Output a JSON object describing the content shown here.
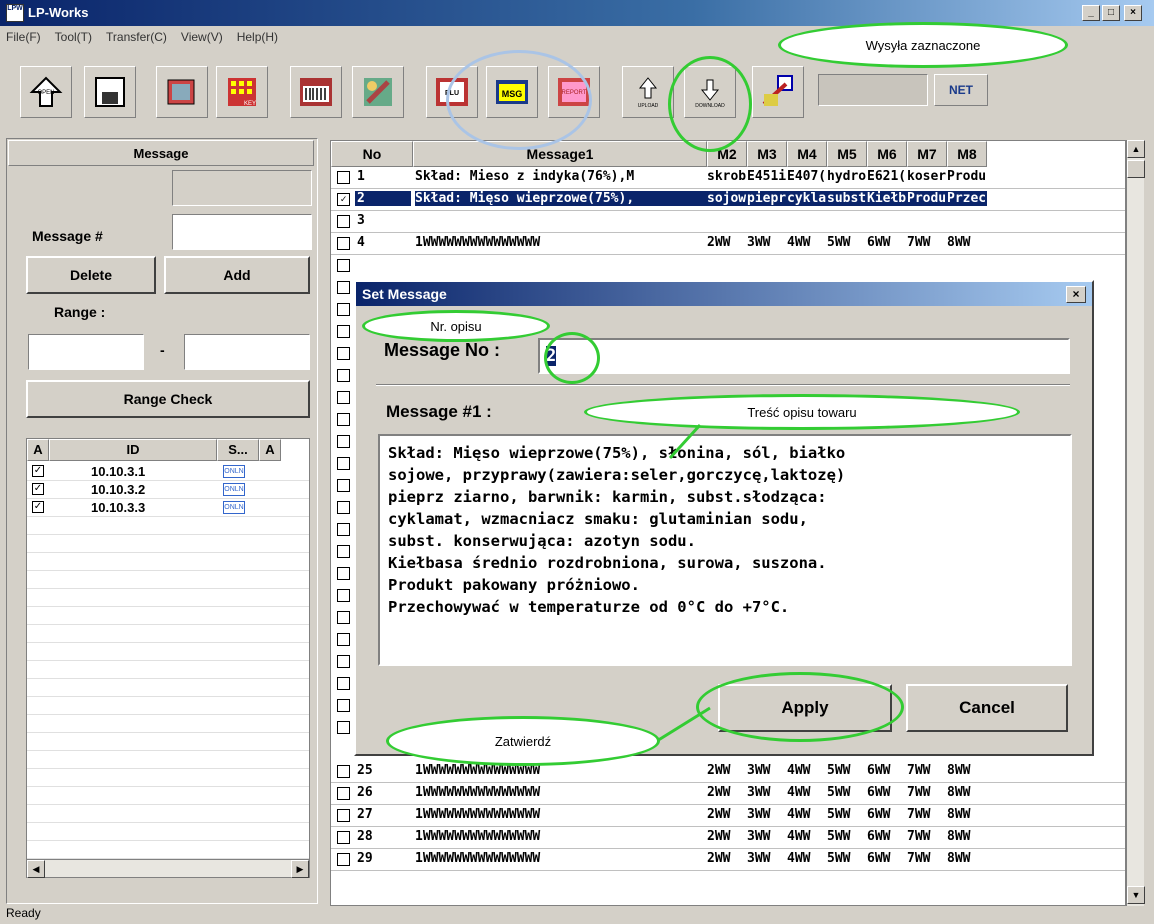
{
  "window": {
    "title": "LP-Works",
    "icon_text": "LPW",
    "min": "_",
    "max": "□",
    "close": "×"
  },
  "menu": [
    "File(F)",
    "Tool(T)",
    "Transfer(C)",
    "View(V)",
    "Help(H)"
  ],
  "toolbar": {
    "buttons": [
      {
        "name": "open-icon",
        "label": "OPEN"
      },
      {
        "name": "save-icon",
        "label": ""
      },
      {
        "name": "layout-icon",
        "label": ""
      },
      {
        "name": "key-icon",
        "label": "KEY"
      },
      {
        "name": "label-icon",
        "label": "LABEL"
      },
      {
        "name": "paint-icon",
        "label": ""
      },
      {
        "name": "plu-icon",
        "label": "PLU"
      },
      {
        "name": "msg-icon",
        "label": "MSG"
      },
      {
        "name": "report-icon",
        "label": "REPORT"
      },
      {
        "name": "upload-icon",
        "label": "UPLOAD"
      },
      {
        "name": "download-icon",
        "label": "DOWNLOAD"
      },
      {
        "name": "config-icon",
        "label": ""
      }
    ],
    "net_label": "NET"
  },
  "left": {
    "header": "Message",
    "message_num_label": "Message #",
    "delete": "Delete",
    "add": "Add",
    "range_label": "Range :",
    "range_sep": "-",
    "range_check": "Range Check",
    "list_headers": [
      "A",
      "ID",
      "S...",
      "A"
    ],
    "ids": [
      "10.10.3.1",
      "10.10.3.2",
      "10.10.3.3"
    ],
    "status_icon_text": "ONLN"
  },
  "grid": {
    "headers": [
      "No",
      "Message1",
      "M2",
      "M3",
      "M4",
      "M5",
      "M6",
      "M7",
      "M8"
    ],
    "rows": [
      {
        "no": "1",
        "m1": "Skład: Mieso z indyka(76%),M",
        "m": [
          "skrob",
          "E451i",
          "E407(",
          "hydro",
          "E621(",
          "koser",
          "Produ"
        ]
      },
      {
        "no": "2",
        "m1": "Skład: Mięso wieprzowe(75%),",
        "m": [
          "sojow",
          "piepr",
          "cykla",
          "subst",
          "Kiełb",
          "Produ",
          "Przec"
        ],
        "selected": true,
        "checked": true
      },
      {
        "no": "3",
        "m1": "",
        "m": [
          "",
          "",
          "",
          "",
          "",
          "",
          ""
        ]
      },
      {
        "no": "4",
        "m1": "1WWWWWWWWWWWWWWW",
        "m": [
          "2WW",
          "3WW",
          "4WW",
          "5WW",
          "6WW",
          "7WW",
          "8WW"
        ]
      },
      {
        "no": "25",
        "m1": "1WWWWWWWWWWWWWWW",
        "m": [
          "2WW",
          "3WW",
          "4WW",
          "5WW",
          "6WW",
          "7WW",
          "8WW"
        ]
      },
      {
        "no": "26",
        "m1": "1WWWWWWWWWWWWWWW",
        "m": [
          "2WW",
          "3WW",
          "4WW",
          "5WW",
          "6WW",
          "7WW",
          "8WW"
        ]
      },
      {
        "no": "27",
        "m1": "1WWWWWWWWWWWWWWW",
        "m": [
          "2WW",
          "3WW",
          "4WW",
          "5WW",
          "6WW",
          "7WW",
          "8WW"
        ]
      },
      {
        "no": "28",
        "m1": "1WWWWWWWWWWWWWWW",
        "m": [
          "2WW",
          "3WW",
          "4WW",
          "5WW",
          "6WW",
          "7WW",
          "8WW"
        ]
      },
      {
        "no": "29",
        "m1": "1WWWWWWWWWWWWWWW",
        "m": [
          "2WW",
          "3WW",
          "4WW",
          "5WW",
          "6WW",
          "7WW",
          "8WW"
        ]
      }
    ]
  },
  "dialog": {
    "title": "Set Message",
    "close": "×",
    "message_no_label": "Message No :",
    "message_no_value": "2",
    "message1_label": "Message #1 :",
    "message_text": "Skład: Mięso wieprzowe(75%), słonina, sól, białko\nsojowe, przyprawy(zawiera:seler,gorczycę,laktozę)\npieprz ziarno, barwnik: karmin, subst.słodząca:\ncyklamat, wzmacniacz smaku: glutaminian sodu,\nsubst. konserwująca: azotyn sodu.\nKiełbasa średnio rozdrobniona, surowa, suszona.\nProdukt pakowany próżniowo.\nPrzechowywać w temperaturze od 0°C do +7°C.",
    "apply": "Apply",
    "cancel": "Cancel"
  },
  "annotations": {
    "send": "Wysyła zaznaczone",
    "nr": "Nr. opisu",
    "content": "Treść opisu towaru",
    "confirm": "Zatwierdź"
  },
  "status": "Ready",
  "colors": {
    "annotation": "#33cc33",
    "selection": "#0a246a"
  }
}
